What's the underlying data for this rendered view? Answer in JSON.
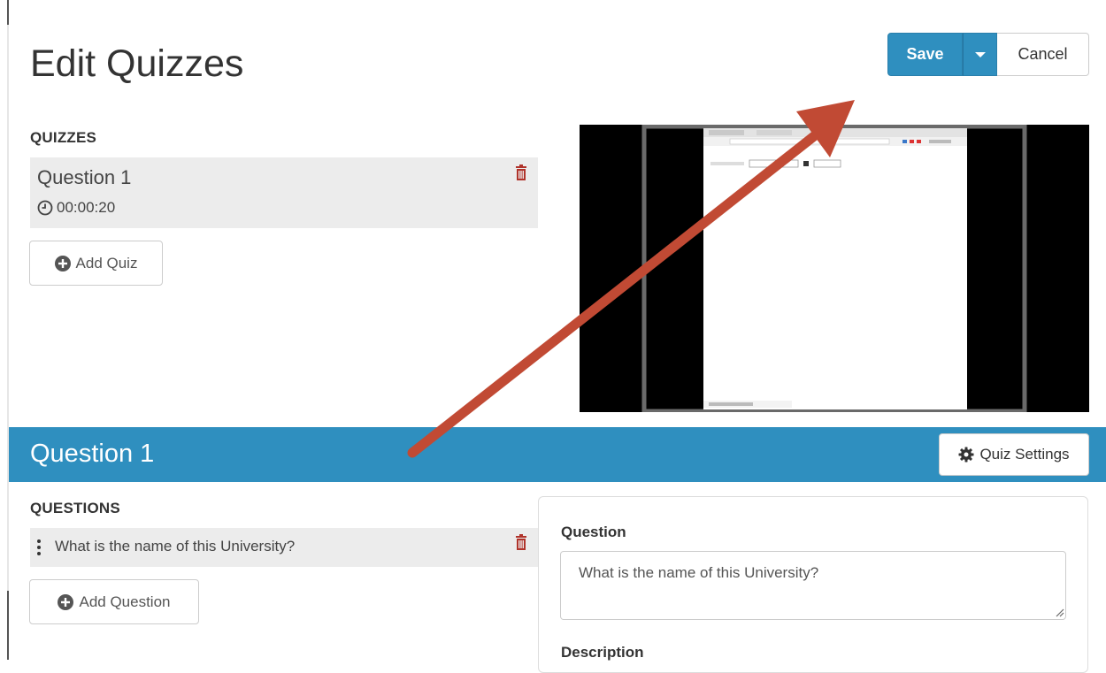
{
  "header": {
    "title": "Edit Quizzes"
  },
  "actions": {
    "save_label": "Save",
    "cancel_label": "Cancel"
  },
  "quizzes": {
    "section_label": "QUIZZES",
    "items": [
      {
        "name": "Question 1",
        "time": "00:00:20"
      }
    ],
    "add_label": "Add Quiz"
  },
  "question_bar": {
    "title": "Question 1",
    "settings_label": "Quiz Settings"
  },
  "questions": {
    "section_label": "QUESTIONS",
    "items": [
      {
        "text": "What is the name of this University?"
      }
    ],
    "add_label": "Add Question"
  },
  "editor": {
    "question_label": "Question",
    "question_value": "What is the name of this University?",
    "description_label": "Description"
  },
  "colors": {
    "accent": "#2f8fbf",
    "delete": "#b0332b",
    "annotation_arrow": "#c14a34"
  },
  "icons": [
    "trash-icon",
    "clock-icon",
    "plus-circle-icon",
    "gear-icon",
    "drag-handle-icon",
    "caret-down-icon"
  ]
}
